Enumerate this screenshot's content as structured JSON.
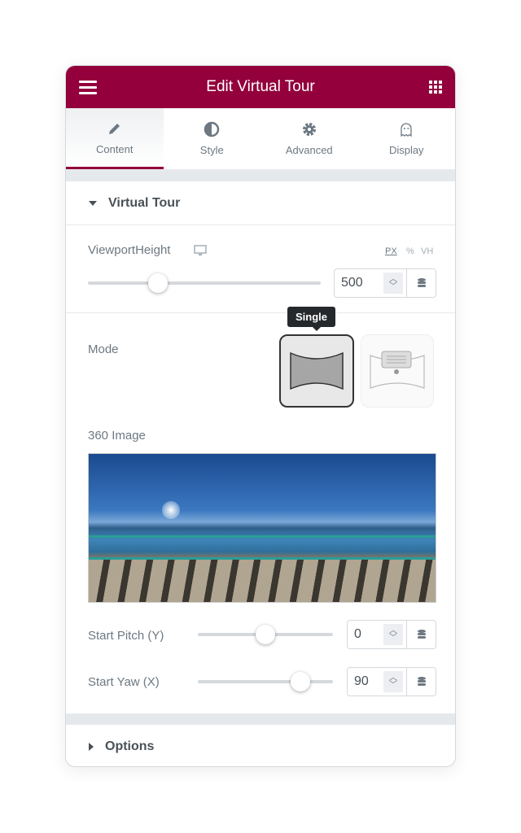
{
  "header": {
    "title": "Edit Virtual Tour",
    "menu_icon": "hamburger-icon",
    "apps_icon": "grid-icon"
  },
  "tabs": [
    {
      "label": "Content",
      "icon": "pencil-icon",
      "active": true
    },
    {
      "label": "Style",
      "icon": "half-circle-icon"
    },
    {
      "label": "Advanced",
      "icon": "gear-icon"
    },
    {
      "label": "Display",
      "icon": "ghost-icon"
    }
  ],
  "section": {
    "title": "Virtual Tour"
  },
  "viewport": {
    "label": "ViewportHeight",
    "units": [
      "PX",
      "%",
      "VH"
    ],
    "selected_unit": "PX",
    "value": "500",
    "slider_percent": 30
  },
  "mode": {
    "label": "Mode",
    "tooltip": "Single",
    "options": [
      "Single",
      "Tour"
    ],
    "selected": "Single"
  },
  "image": {
    "label": "360 Image"
  },
  "pitch": {
    "label": "Start Pitch (Y)",
    "value": "0",
    "slider_percent": 50
  },
  "yaw": {
    "label": "Start Yaw (X)",
    "value": "90",
    "slider_percent": 75
  },
  "options": {
    "title": "Options"
  },
  "colors": {
    "accent": "#93003c"
  }
}
